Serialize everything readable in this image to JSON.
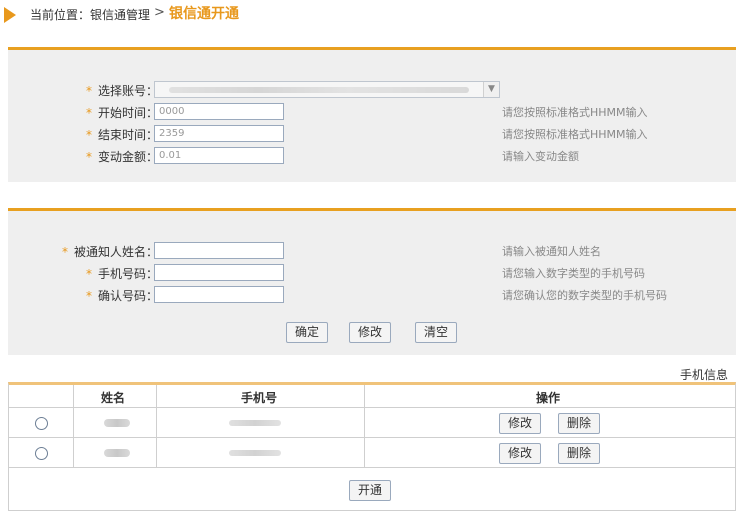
{
  "breadcrumb": {
    "prefix": "当前位置：银信通管理",
    "separator": ">",
    "current": "银信通开通"
  },
  "form1": {
    "fields": [
      {
        "label": "选择账号：",
        "value": "",
        "hint": ""
      },
      {
        "label": "开始时间：",
        "value": "0000",
        "hint": "请您按照标准格式HHMM输入"
      },
      {
        "label": "结束时间：",
        "value": "2359",
        "hint": "请您按照标准格式HHMM输入"
      },
      {
        "label": "变动金额：",
        "value": "0.01",
        "hint": "请输入变动金额"
      }
    ],
    "required_mark": "*"
  },
  "form2": {
    "fields": [
      {
        "label": "被通知人姓名：",
        "value": "",
        "hint": "请输入被通知人姓名"
      },
      {
        "label": "手机号码：",
        "value": "",
        "hint": "请您输入数字类型的手机号码"
      },
      {
        "label": "确认号码：",
        "value": "",
        "hint": "请您确认您的数字类型的手机号码"
      }
    ],
    "buttons": {
      "confirm": "确定",
      "modify": "修改",
      "clear": "清空"
    }
  },
  "table": {
    "caption": "手机信息",
    "headers": {
      "name": "姓名",
      "phone": "手机号",
      "action": "操作"
    },
    "rows": [
      {
        "modify": "修改",
        "delete": "删除"
      },
      {
        "modify": "修改",
        "delete": "删除"
      }
    ],
    "open_button": "开通"
  },
  "colors": {
    "accent": "#e8981c",
    "panel_bg": "#efefef",
    "hint": "#888888"
  }
}
